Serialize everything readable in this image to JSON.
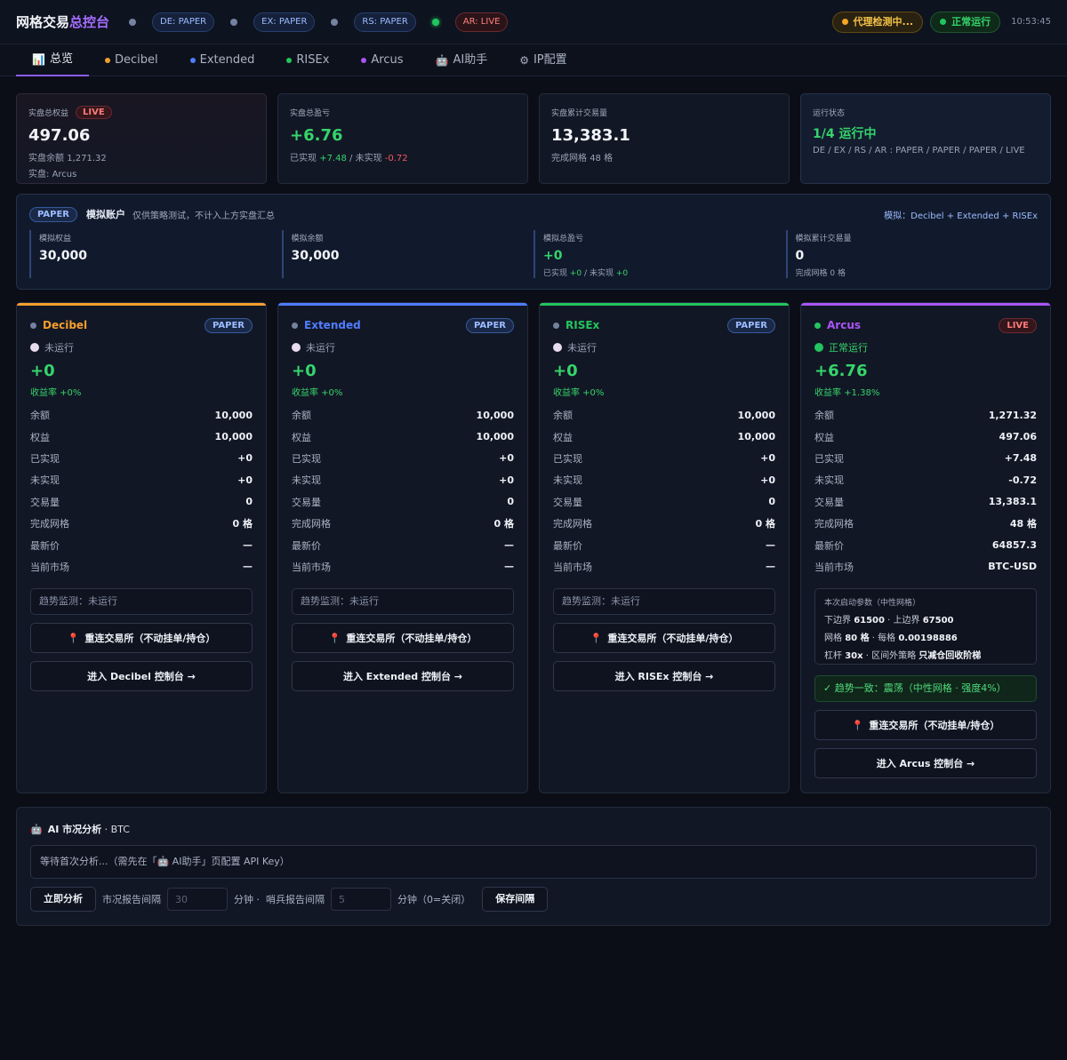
{
  "header": {
    "title_main": "网格交易",
    "title_accent": "总控台",
    "modes": [
      {
        "label": "DE: PAPER",
        "live": false
      },
      {
        "label": "EX: PAPER",
        "live": false
      },
      {
        "label": "RS: PAPER",
        "live": false
      },
      {
        "label": "AR: LIVE",
        "live": true
      }
    ],
    "proxy_status": "代理检测中...",
    "run_status": "正常运行",
    "clock": "10:53:45"
  },
  "tabs": [
    {
      "label": "总览",
      "icon": "📊",
      "active": true
    },
    {
      "label": "Decibel",
      "dot": "#f59e2c"
    },
    {
      "label": "Extended",
      "dot": "#4f7dff"
    },
    {
      "label": "RISEx",
      "dot": "#22c55e"
    },
    {
      "label": "Arcus",
      "dot": "#a855f7"
    },
    {
      "label": "AI助手",
      "icon": "🤖"
    },
    {
      "label": "IP配置",
      "icon": "⚙"
    }
  ],
  "summary": {
    "equity": {
      "label": "实盘总权益",
      "badge": "LIVE",
      "value": "497.06",
      "balance_label": "实盘余额",
      "balance": "1,271.32",
      "live_label": "实盘:",
      "live_ex": "Arcus"
    },
    "pnl": {
      "label": "实盘总盈亏",
      "value": "+6.76",
      "realized_label": "已实现",
      "realized": "+7.48",
      "sep": "/ 未实现",
      "unrealized": "-0.72"
    },
    "volume": {
      "label": "实盘累计交易量",
      "value": "13,383.1",
      "grids_label": "完成网格",
      "grids": "48 格"
    },
    "status": {
      "label": "运行状态",
      "value": "1/4 运行中",
      "sub": "DE / EX / RS / AR : PAPER / PAPER / PAPER / LIVE"
    }
  },
  "paper": {
    "pill": "PAPER",
    "title": "模拟账户",
    "desc": "仅供策略测试，不计入上方实盘汇总",
    "right": "模拟：Decibel + Extended + RISEx",
    "stats": [
      {
        "label": "模拟权益",
        "value": "30,000",
        "green": false,
        "sub": ""
      },
      {
        "label": "模拟余额",
        "value": "30,000",
        "green": false,
        "sub": ""
      },
      {
        "label": "模拟总盈亏",
        "value": "+0",
        "green": true,
        "sub_a": "已实现",
        "sub_b": "+0",
        "sub_c": "/ 未实现",
        "sub_d": "+0"
      },
      {
        "label": "模拟累计交易量",
        "value": "0",
        "green": false,
        "sub": "完成网格 0 格"
      }
    ]
  },
  "row_labels": [
    "余额",
    "权益",
    "已实现",
    "未实现",
    "交易量",
    "完成网格",
    "最新价",
    "当前市场"
  ],
  "exchanges": [
    {
      "name": "Decibel",
      "color": "#f59e2c",
      "mode": "PAPER",
      "live": false,
      "status": "未运行",
      "pnl": "+0",
      "rate": "收益率 +0%",
      "values": [
        "10,000",
        "10,000",
        "+0",
        "+0",
        "0",
        "0 格",
        "—",
        "—"
      ],
      "trend": "趋势监测：未运行",
      "reconnect": "重连交易所（不动挂单/持仓）",
      "enter": "进入 Decibel 控制台 →"
    },
    {
      "name": "Extended",
      "color": "#4f7dff",
      "mode": "PAPER",
      "live": false,
      "status": "未运行",
      "pnl": "+0",
      "rate": "收益率 +0%",
      "values": [
        "10,000",
        "10,000",
        "+0",
        "+0",
        "0",
        "0 格",
        "—",
        "—"
      ],
      "trend": "趋势监测：未运行",
      "reconnect": "重连交易所（不动挂单/持仓）",
      "enter": "进入 Extended 控制台 →"
    },
    {
      "name": "RISEx",
      "color": "#22c55e",
      "mode": "PAPER",
      "live": false,
      "status": "未运行",
      "pnl": "+0",
      "rate": "收益率 +0%",
      "values": [
        "10,000",
        "10,000",
        "+0",
        "+0",
        "0",
        "0 格",
        "—",
        "—"
      ],
      "trend": "趋势监测：未运行",
      "reconnect": "重连交易所（不动挂单/持仓）",
      "enter": "进入 RISEx 控制台 →"
    },
    {
      "name": "Arcus",
      "color": "#a855f7",
      "mode": "LIVE",
      "live": true,
      "status": "正常运行",
      "pnl": "+6.76",
      "rate": "收益率 +1.38%",
      "values": [
        "1,271.32",
        "497.06",
        "+7.48",
        "-0.72",
        "13,383.1",
        "48 格",
        "64857.3",
        "BTC-USD"
      ],
      "params": {
        "title": "本次启动参数（中性网格）",
        "lower_label": "下边界",
        "lower": "61500",
        "upper_label": "· 上边界",
        "upper": "67500",
        "grid_label": "网格",
        "grid": "80 格",
        "per_label": "· 每格",
        "per": "0.00198886",
        "lev_label": "杠杆",
        "lev": "30x",
        "out_label": "· 区间外策略",
        "out": "只减仓回收阶梯"
      },
      "trend": "✓ 趋势一致：震荡（中性网格 · 强度4%）",
      "reconnect": "重连交易所（不动挂单/持仓）",
      "enter": "进入 Arcus 控制台 →"
    }
  ],
  "ai": {
    "icon": "🤖",
    "title": "AI 市况分析",
    "symbol": "· BTC",
    "message": "等待首次分析...（需先在「🤖 AI助手」页配置 API Key）",
    "analyze_label": "立即分析",
    "report_label": "市况报告间隔",
    "report_placeholder": "30",
    "minutes_label": "分钟 ·",
    "sentinel_label": "哨兵报告间隔",
    "sentinel_placeholder": "5",
    "minutes_off_label": "分钟（0=关闭）",
    "save_label": "保存间隔"
  }
}
